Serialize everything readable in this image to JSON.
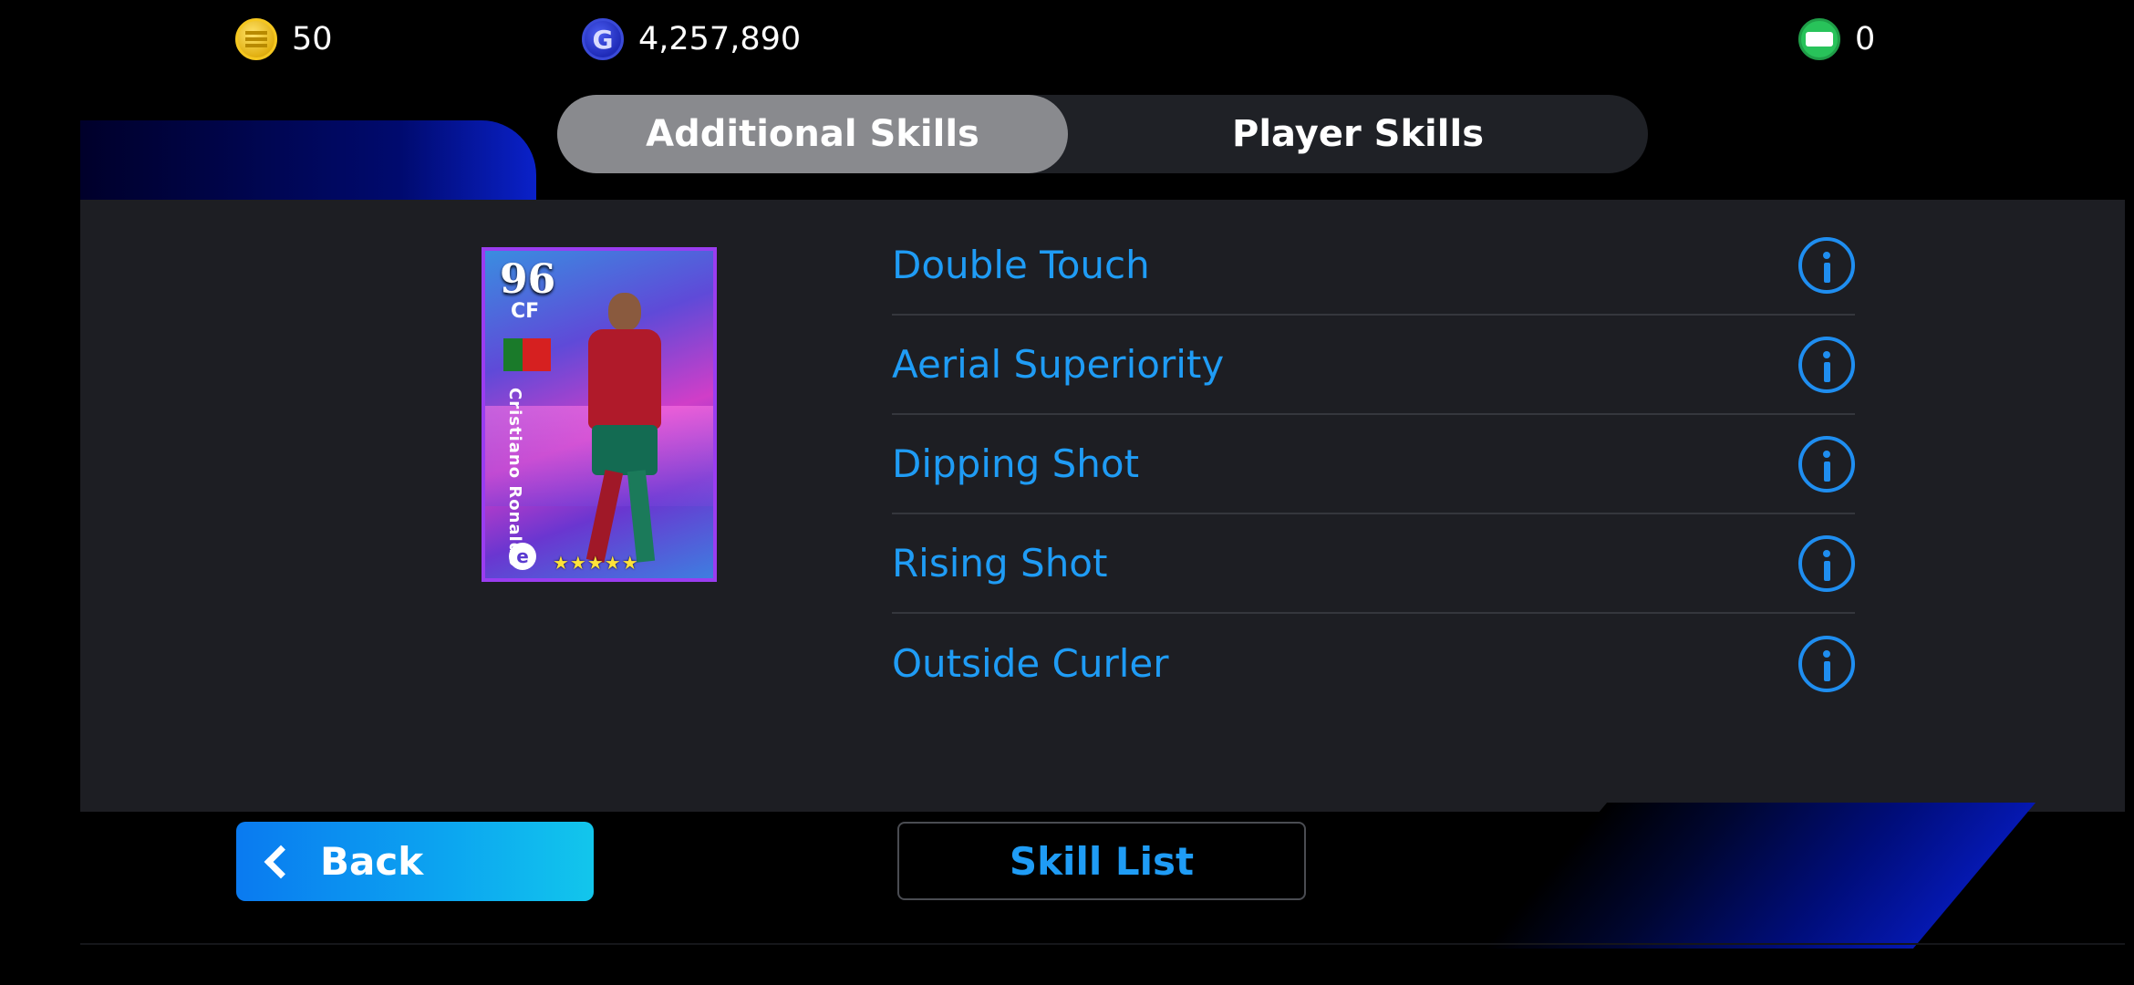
{
  "currencies": {
    "coins": "50",
    "gp": "4,257,890",
    "gp_icon_letter": "G",
    "tickets": "0"
  },
  "tabs": [
    {
      "label": "Additional Skills",
      "active": true
    },
    {
      "label": "Player Skills",
      "active": false
    }
  ],
  "player_card": {
    "rating": "96",
    "position": "CF",
    "name": "Cristiano Ronaldo",
    "logo_letter": "e",
    "stars": "★★★★★"
  },
  "skills": [
    {
      "name": "Double Touch"
    },
    {
      "name": "Aerial Superiority"
    },
    {
      "name": "Dipping Shot"
    },
    {
      "name": "Rising Shot"
    },
    {
      "name": "Outside Curler"
    }
  ],
  "buttons": {
    "back": "Back",
    "skill_list": "Skill List"
  },
  "colors": {
    "accent_blue": "#1f9cf5",
    "panel": "#1d1e23",
    "card_border": "#9a3df0"
  }
}
